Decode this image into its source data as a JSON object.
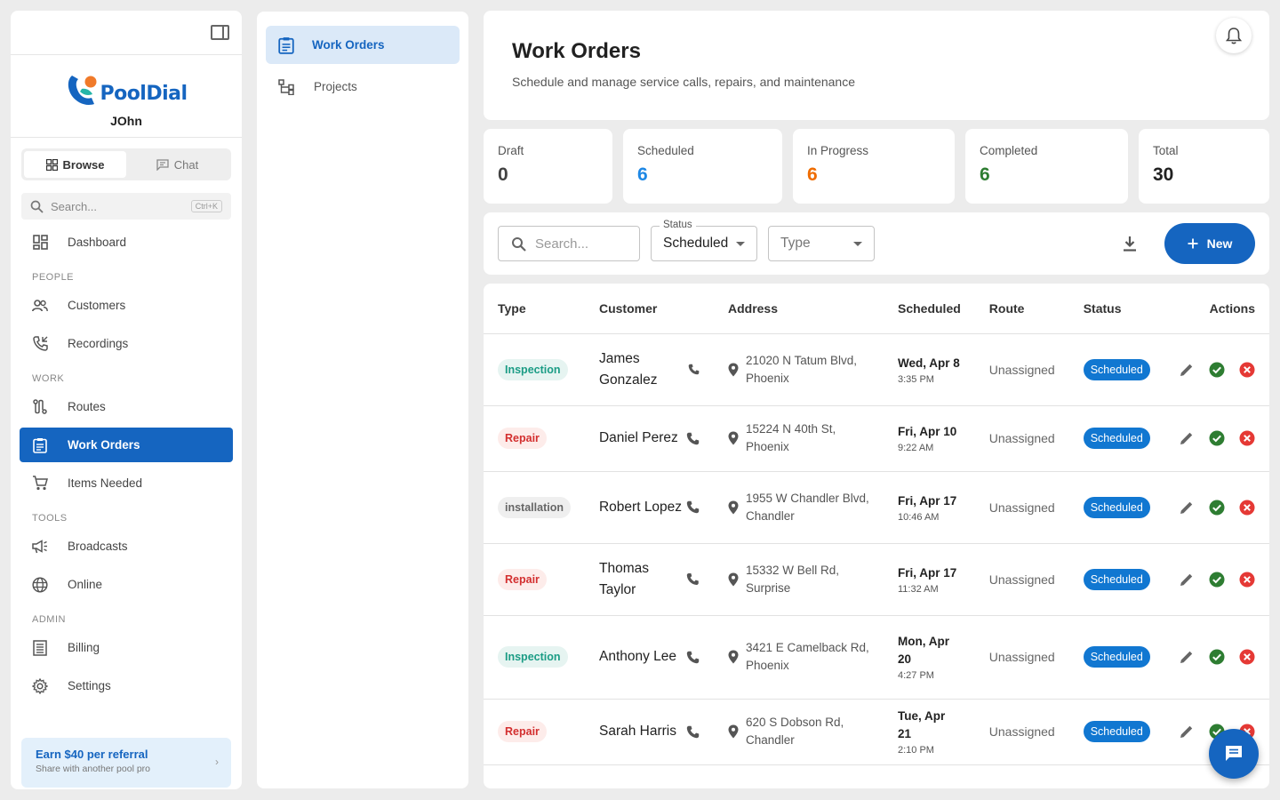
{
  "brand": {
    "name": "PoolDial",
    "user": "JOhn"
  },
  "sidebar": {
    "segments": [
      {
        "label": "Browse"
      },
      {
        "label": "Chat"
      }
    ],
    "search_placeholder": "Search...",
    "search_shortcut": "Ctrl+K",
    "dashboard": "Dashboard",
    "sections": {
      "people": "PEOPLE",
      "work": "WORK",
      "tools": "TOOLS",
      "admin": "ADMIN"
    },
    "items": {
      "customers": "Customers",
      "recordings": "Recordings",
      "routes": "Routes",
      "work_orders": "Work Orders",
      "items_needed": "Items Needed",
      "broadcasts": "Broadcasts",
      "online": "Online",
      "billing": "Billing",
      "settings": "Settings"
    },
    "referral": {
      "title": "Earn $40 per referral",
      "subtitle": "Share with another pool pro"
    }
  },
  "subnav": {
    "items": [
      {
        "label": "Work Orders"
      },
      {
        "label": "Projects"
      }
    ]
  },
  "header": {
    "title": "Work Orders",
    "subtitle": "Schedule and manage service calls, repairs, and maintenance"
  },
  "stats": [
    {
      "label": "Draft",
      "value": "0",
      "color": "#424242"
    },
    {
      "label": "Scheduled",
      "value": "6",
      "color": "#1e88e5"
    },
    {
      "label": "In Progress",
      "value": "6",
      "color": "#ef6c00"
    },
    {
      "label": "Completed",
      "value": "6",
      "color": "#2e7d32"
    },
    {
      "label": "Total",
      "value": "30",
      "color": "#212121"
    }
  ],
  "toolbar": {
    "search_placeholder": "Search...",
    "status_label": "Status",
    "status_value": "Scheduled",
    "type_placeholder": "Type",
    "new_label": "New"
  },
  "table": {
    "headers": {
      "type": "Type",
      "customer": "Customer",
      "address": "Address",
      "scheduled": "Scheduled",
      "route": "Route",
      "status": "Status",
      "actions": "Actions"
    },
    "rows": [
      {
        "type": "Inspection",
        "customer": "James Gonzalez",
        "address": "21020 N Tatum Blvd, Phoenix",
        "date": "Wed, Apr 8",
        "time": "3:35 PM",
        "route": "Unassigned",
        "status": "Scheduled"
      },
      {
        "type": "Repair",
        "customer": "Daniel Perez",
        "address": "15224 N 40th St, Phoenix",
        "date": "Fri, Apr 10",
        "time": "9:22 AM",
        "route": "Unassigned",
        "status": "Scheduled"
      },
      {
        "type": "installation",
        "customer": "Robert Lopez",
        "address": "1955 W Chandler Blvd, Chandler",
        "date": "Fri, Apr 17",
        "time": "10:46 AM",
        "route": "Unassigned",
        "status": "Scheduled"
      },
      {
        "type": "Repair",
        "customer": "Thomas Taylor",
        "address": "15332 W Bell Rd, Surprise",
        "date": "Fri, Apr 17",
        "time": "11:32 AM",
        "route": "Unassigned",
        "status": "Scheduled"
      },
      {
        "type": "Inspection",
        "customer": "Anthony Lee",
        "address": "3421 E Camelback Rd, Phoenix",
        "date": "Mon, Apr 20",
        "time": "4:27 PM",
        "route": "Unassigned",
        "status": "Scheduled"
      },
      {
        "type": "Repair",
        "customer": "Sarah Harris",
        "address": "620 S Dobson Rd, Chandler",
        "date": "Tue, Apr 21",
        "time": "2:10 PM",
        "route": "Unassigned",
        "status": "Scheduled"
      }
    ]
  }
}
